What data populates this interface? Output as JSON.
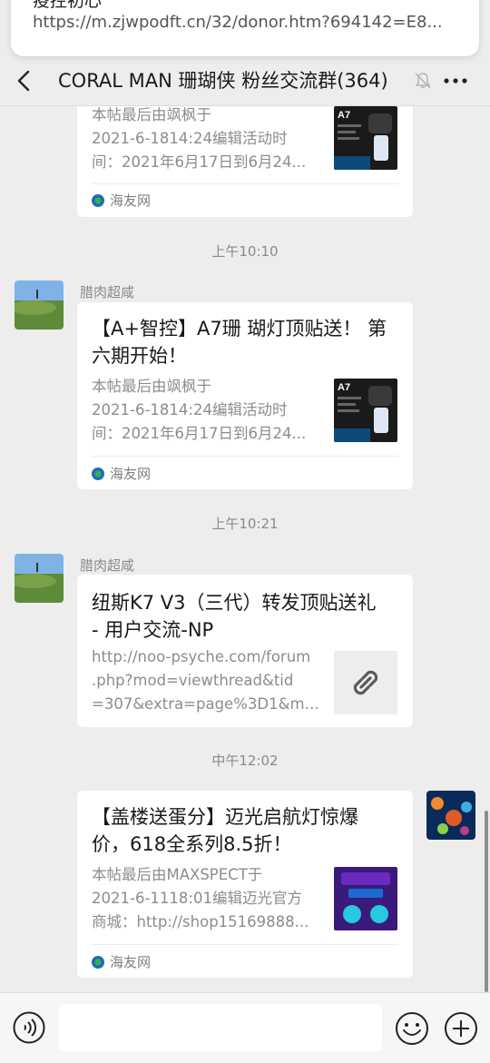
{
  "notification": {
    "title_partial": "疫控初心",
    "url": "https://m.zjwpodft.cn/32/donor.htm?694142=E8..."
  },
  "header": {
    "title": "CORAL MAN 珊瑚侠 粉丝交流群(364)",
    "back_icon": "chevron-left-icon",
    "mute_icon": "bell-off-icon",
    "more_icon": "more-dots-icon"
  },
  "messages": [
    {
      "type": "link-card",
      "cut": true,
      "desc": [
        "本帖最后由飒枫于",
        "2021-6-1814:24编辑活动时",
        "间：2021年6月17日到6月24..."
      ],
      "source": "海友网",
      "thumb": "A7"
    },
    {
      "timestamp": "上午10:10",
      "sender": "腊肉超咸",
      "type": "link-card",
      "title": "【A+智控】A7珊 瑚灯顶贴送！ 第六期开始！",
      "title_lines": [
        "【A+智控】A7珊 瑚灯顶贴送！ 第",
        "六期开始！"
      ],
      "desc": [
        "本帖最后由飒枫于",
        "2021-6-1814:24编辑活动时",
        "间：2021年6月17日到6月24..."
      ],
      "source": "海友网",
      "thumb": "A7"
    },
    {
      "timestamp": "上午10:21",
      "sender": "腊肉超咸",
      "type": "link-card",
      "title_lines": [
        "纽斯K7 V3（三代）转发顶贴送礼",
        "- 用户交流-NP"
      ],
      "desc": [
        "http://noo-psyche.com/forum",
        ".php?mod=viewthread&tid",
        "=307&extra=page%3D1&mo..."
      ],
      "thumb_icon": "link-icon"
    },
    {
      "timestamp": "中午12:02",
      "type": "link-card",
      "outgoing": true,
      "title_lines": [
        "【盖楼送蛋分】迈光启航灯惊爆",
        "价，618全系列8.5折！"
      ],
      "desc": [
        "本帖最后由MAXSPECT于",
        "2021-6-1118:01编辑迈光官方",
        "商城：http://shop15169888..."
      ],
      "source": "海友网"
    }
  ],
  "input": {
    "placeholder": "",
    "voice_icon": "voice-icon",
    "emoji_icon": "emoji-icon",
    "plus_icon": "plus-icon"
  }
}
